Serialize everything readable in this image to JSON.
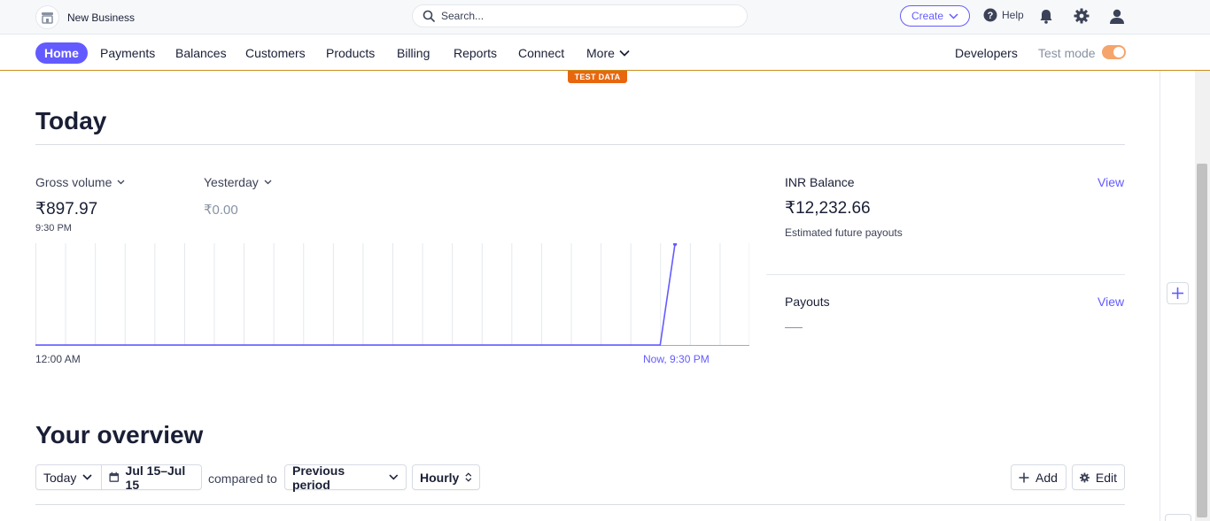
{
  "header": {
    "account_name": "New Business",
    "search_placeholder": "Search...",
    "create_label": "Create",
    "help_label": "Help"
  },
  "nav": {
    "items": [
      "Home",
      "Payments",
      "Balances",
      "Customers",
      "Products",
      "Billing",
      "Reports",
      "Connect",
      "More"
    ],
    "active": "Home",
    "developers_label": "Developers",
    "test_mode_label": "Test mode",
    "test_mode_on": true
  },
  "badge": "TEST DATA",
  "today": {
    "title": "Today",
    "gross_volume": {
      "label": "Gross volume",
      "value": "₹897.97",
      "time": "9:30 PM"
    },
    "yesterday": {
      "label": "Yesterday",
      "value": "₹0.00"
    },
    "chart_start_label": "12:00 AM",
    "chart_end_label": "Now, 9:30 PM"
  },
  "chart_data": {
    "type": "line",
    "title": "",
    "xlabel": "",
    "ylabel": "",
    "x": [
      "00:00",
      "01:00",
      "02:00",
      "03:00",
      "04:00",
      "05:00",
      "06:00",
      "07:00",
      "08:00",
      "09:00",
      "10:00",
      "11:00",
      "12:00",
      "13:00",
      "14:00",
      "15:00",
      "16:00",
      "17:00",
      "18:00",
      "19:00",
      "20:00",
      "21:00",
      "21:30"
    ],
    "series": [
      {
        "values": [
          0,
          0,
          0,
          0,
          0,
          0,
          0,
          0,
          0,
          0,
          0,
          0,
          0,
          0,
          0,
          0,
          0,
          0,
          0,
          0,
          0,
          0,
          897.97
        ]
      }
    ],
    "ylim": [
      0,
      897.97
    ],
    "grid": true,
    "x_axis_span_hours": 24,
    "ticks": [
      "12:00 AM",
      "Now, 9:30 PM"
    ],
    "line_color": "#635bff"
  },
  "balance": {
    "title": "INR Balance",
    "view_label": "View",
    "value": "₹12,232.66",
    "subtitle": "Estimated future payouts"
  },
  "payouts": {
    "title": "Payouts",
    "view_label": "View"
  },
  "overview": {
    "title": "Your overview",
    "range_label": "Today",
    "date_label": "Jul 15–Jul 15",
    "compared_label": "compared to",
    "compare_label": "Previous period",
    "interval_label": "Hourly",
    "add_label": "Add",
    "edit_label": "Edit"
  },
  "colors": {
    "accent": "#635bff",
    "test_orange": "#e8670e",
    "toggle": "#f5a46b"
  }
}
